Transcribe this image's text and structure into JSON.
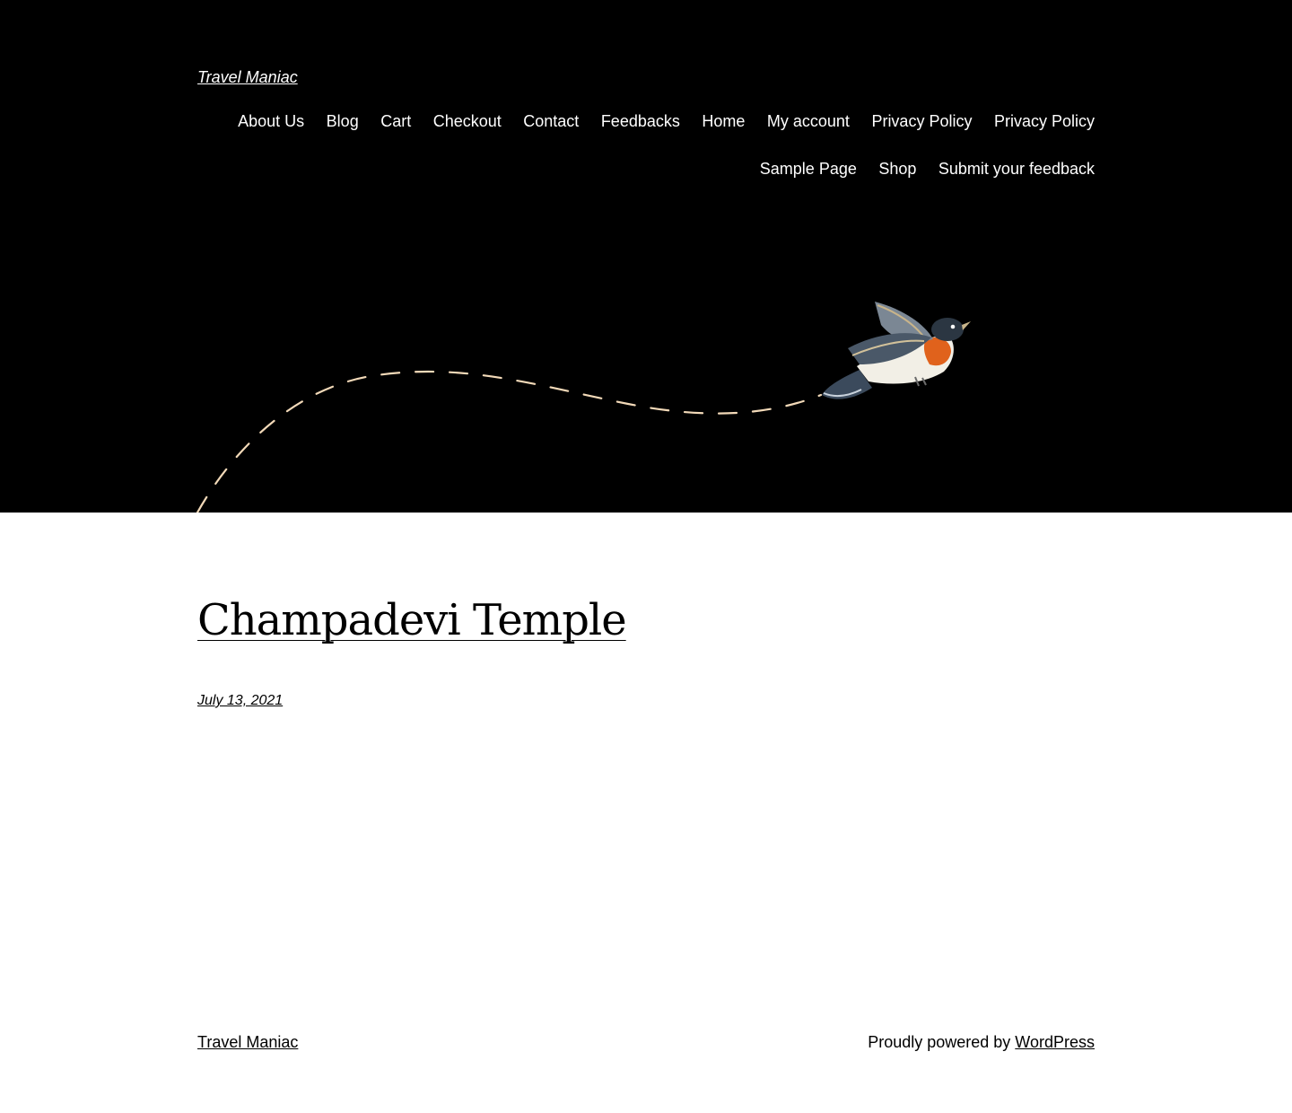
{
  "header": {
    "site_title": "Travel Maniac",
    "nav": [
      "About Us",
      "Blog",
      "Cart",
      "Checkout",
      "Contact",
      "Feedbacks",
      "Home",
      "My account",
      "Privacy Policy",
      "Privacy Policy",
      "Sample Page",
      "Shop",
      "Submit your feedback"
    ],
    "background_color": "#000000",
    "illustration": "bird-in-flight-with-dashed-trail"
  },
  "post": {
    "title": "Champadevi Temple",
    "date": "July 13, 2021"
  },
  "footer": {
    "site_title": "Travel Maniac",
    "credit_prefix": "Proudly powered by",
    "credit_link": "WordPress"
  },
  "colors": {
    "trail": "#f2d9b8",
    "bird_breast": "#e0621c",
    "bird_wing": "#3b4a5c"
  }
}
